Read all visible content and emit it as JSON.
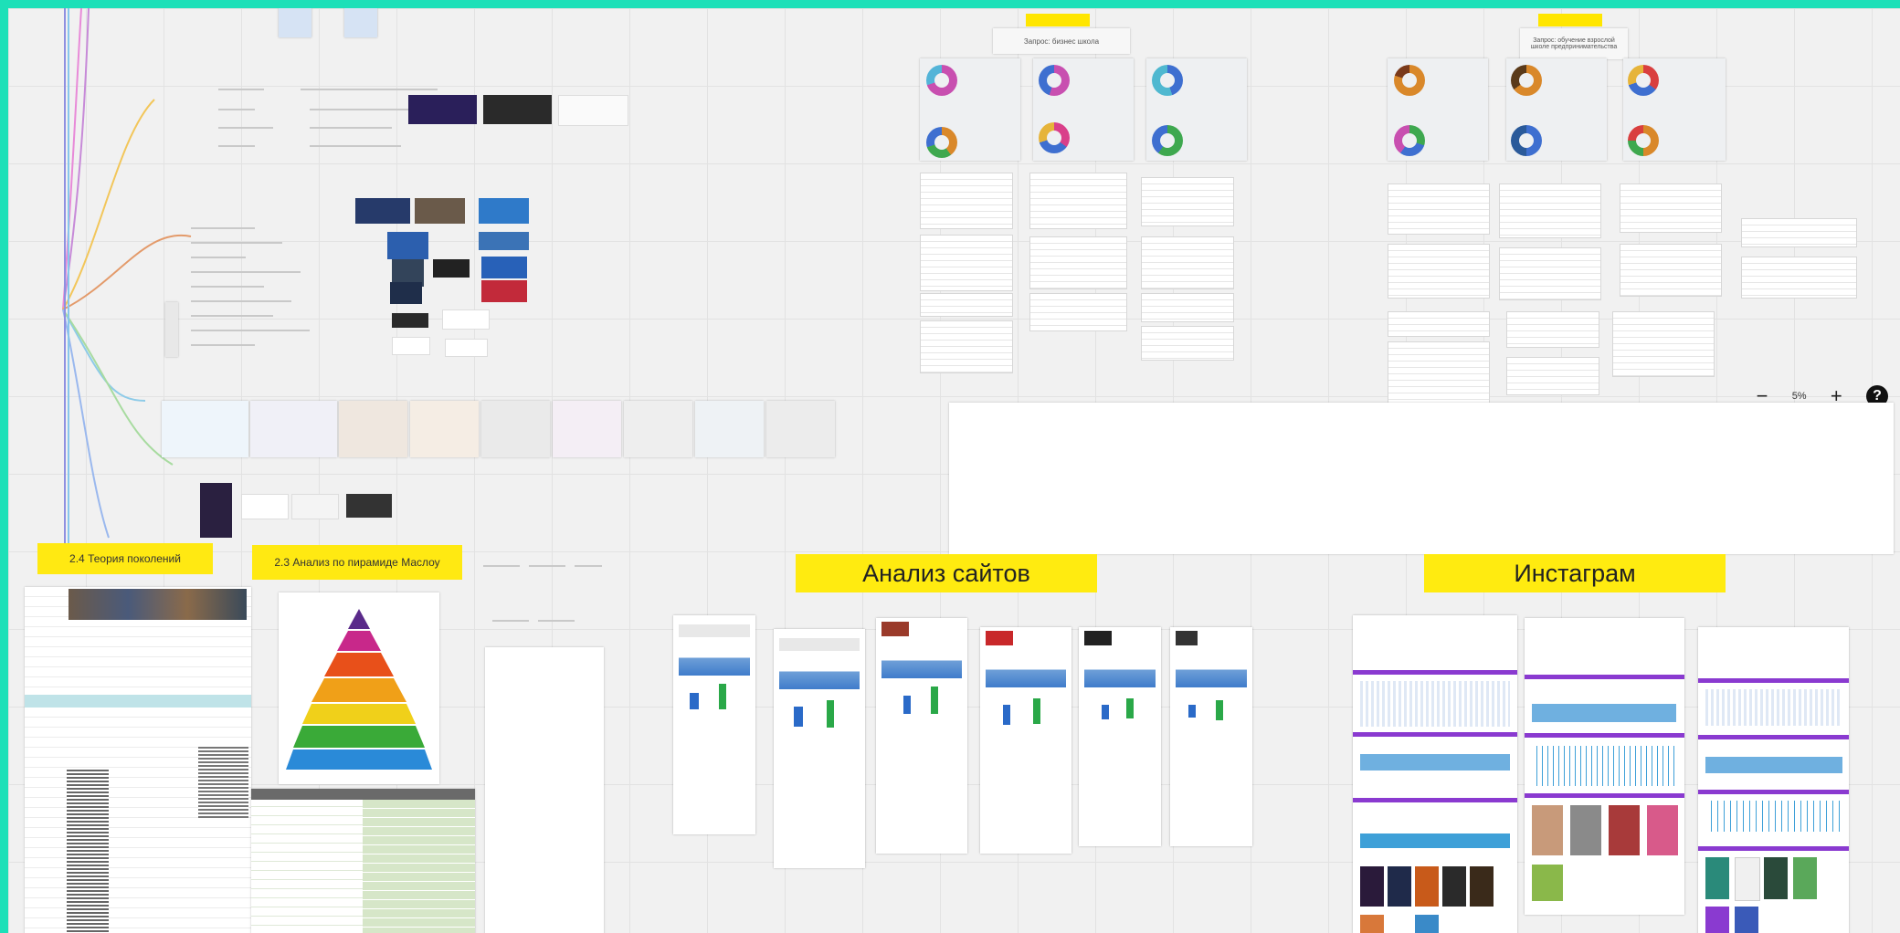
{
  "board": {
    "stickies": {
      "site_analysis": "Анализ сайтов",
      "instagram": "Инстаграм",
      "generations": "2.4 Теория поколений",
      "maslow": "2.3 Анализ по пирамиде Маслоу",
      "business_school_request": "Запрос: бизнес школа",
      "education_request": "Запрос: обучение взрослой школе предпринимательства"
    }
  },
  "zoom": {
    "minus_label": "−",
    "level": "5%",
    "plus_label": "+",
    "help_label": "?"
  },
  "colors": {
    "frame_border": "#1de0b8",
    "sticky": "#ffeb10",
    "canvas": "#f1f1f1"
  }
}
